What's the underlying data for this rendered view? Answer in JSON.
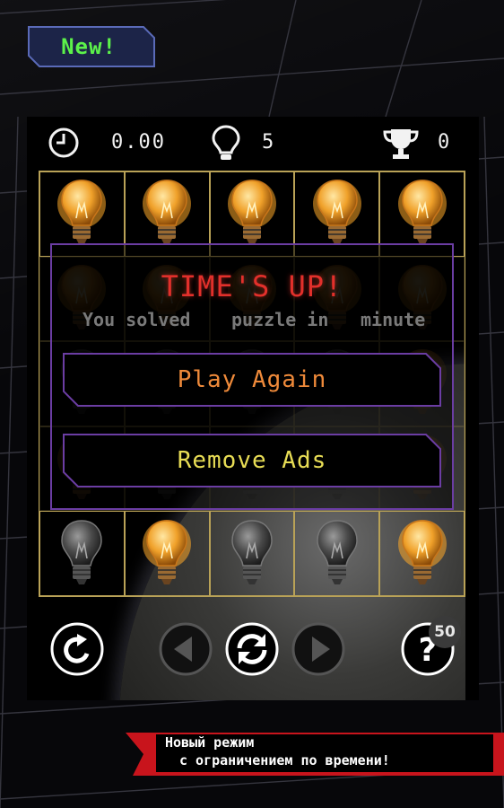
{
  "badge": {
    "label": "New!"
  },
  "stats": {
    "timer": "0.00",
    "hints": "5",
    "trophies": "0"
  },
  "board": {
    "rows": [
      [
        "on",
        "on",
        "on",
        "on",
        "on"
      ],
      [
        "on",
        "on",
        "on",
        "on",
        "on"
      ],
      [
        "off",
        "off",
        "off",
        "off",
        "on"
      ],
      [
        "on",
        "off",
        "off",
        "off",
        "on"
      ],
      [
        "off",
        "on",
        "off",
        "off",
        "on"
      ]
    ]
  },
  "dialog": {
    "title": "TIME'S UP!",
    "subtitle_parts": [
      "You solved",
      "puzzle in",
      "minute"
    ],
    "play_again_label": "Play Again",
    "remove_ads_label": "Remove Ads"
  },
  "controls": {
    "hint_cost": "50"
  },
  "promo": {
    "line1": "Новый режим",
    "line2": "с ограничением по времени!"
  },
  "colors": {
    "badge_text": "#5cf24a",
    "title": "#e2302b",
    "play_again": "#ef8a3a",
    "remove_ads": "#e8dd55",
    "dialog_border": "#6b3da3",
    "grid_line": "#b9a257",
    "promo_red": "#c8141c"
  },
  "icons": [
    "clock-icon",
    "lightbulb-icon",
    "trophy-icon",
    "undo-icon",
    "previous-icon",
    "restart-icon",
    "next-icon",
    "help-icon"
  ]
}
